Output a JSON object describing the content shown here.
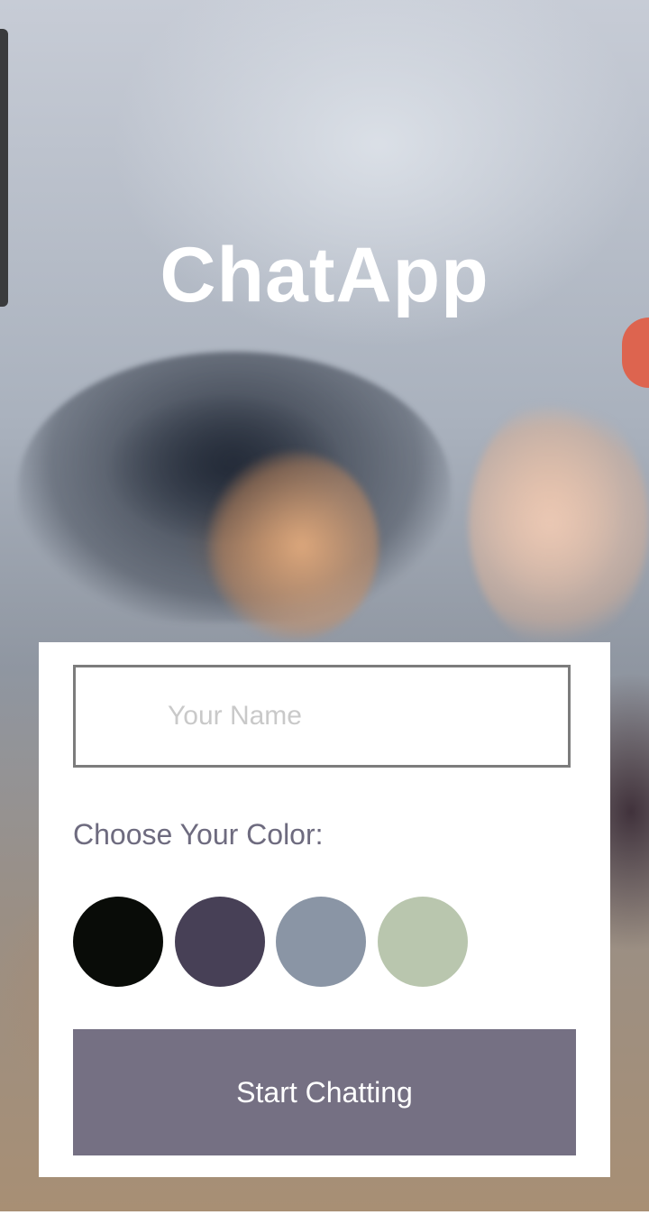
{
  "app": {
    "title": "ChatApp"
  },
  "form": {
    "name_placeholder": "Your Name",
    "name_value": "",
    "color_label": "Choose Your Color:",
    "colors": [
      {
        "name": "black",
        "hex": "#090C08"
      },
      {
        "name": "dark-purple",
        "hex": "#474056"
      },
      {
        "name": "gray-blue",
        "hex": "#8A95A5"
      },
      {
        "name": "sage-green",
        "hex": "#B9C6AE"
      }
    ],
    "start_button_label": "Start Chatting",
    "start_button_color": "#757083"
  }
}
